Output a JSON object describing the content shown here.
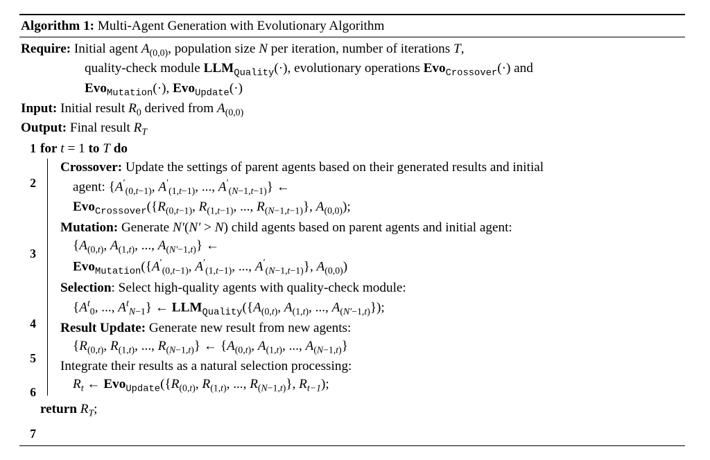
{
  "algo": {
    "number_label": "Algorithm 1:",
    "title": "Multi-Agent Generation with Evolutionary Algorithm",
    "require_label": "Require:",
    "input_label": "Input:",
    "output_label": "Output:",
    "for_kw": "for",
    "to_kw": "to",
    "do_kw": "do",
    "return_kw": "return",
    "require": {
      "l1_a": "Initial agent ",
      "l1_b": ", population size ",
      "l1_c": " per iteration, number of iterations ",
      "l1_d": ",",
      "l2_a": "quality-check module ",
      "l2_b": "(·), evolutionary operations ",
      "l2_c": "(·) and",
      "l3_a": "(·), ",
      "l3_b": "(·)"
    },
    "input_text_a": "Initial result ",
    "input_text_b": " derived from ",
    "output_text_a": "Final result ",
    "loop_var": "t",
    "loop_from": "1",
    "loop_to": "T",
    "steps": {
      "crossover_label": "Crossover:",
      "crossover_text": " Update the settings of parent agents based on their generated results and initial",
      "crossover_cont": "agent: ",
      "mutation_label": "Mutation:",
      "mutation_text_a": " Generate ",
      "mutation_text_b": " child agents based on parent agents and initial agent:",
      "selection_label": "Selection",
      "selection_text": ": Select high-quality agents with quality-check module:",
      "result_label": "Result Update:",
      "result_text": " Generate new result from new agents:",
      "integrate_text": "Integrate their results as a natural selection processing:"
    },
    "line_numbers": [
      "1",
      "2",
      "3",
      "4",
      "5",
      "6",
      "7"
    ],
    "sym": {
      "A00": "A",
      "N": "N",
      "T": "T",
      "Nprime": "N′",
      "R0": "R",
      "RT": "R",
      "Rt": "R",
      "arrow": "←",
      "LLM": "LLM",
      "Evo": "Evo",
      "op_quality": "Quality",
      "op_crossover": "Crossover",
      "op_mutation": "Mutation",
      "op_update": "Update",
      "zero": "0",
      "Tsub": "T",
      "tsub": "t"
    }
  }
}
